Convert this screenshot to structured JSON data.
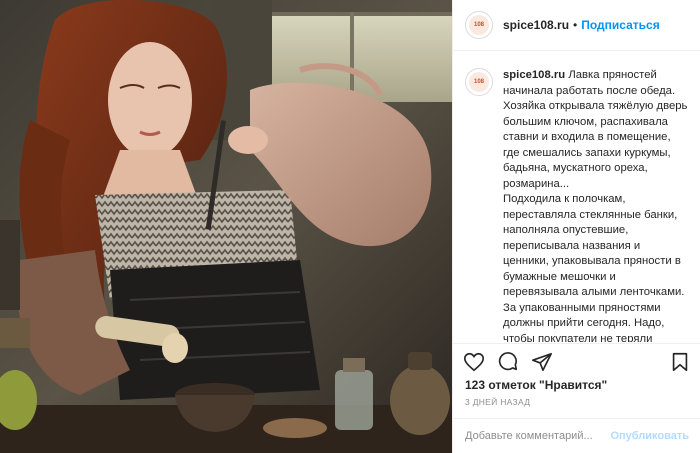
{
  "post": {
    "photo_alt": "post-photo",
    "username": "spice108.ru",
    "separator": "•",
    "follow_label": "Подписаться",
    "avatar_logo_text": "108",
    "caption_username": "spice108.ru",
    "caption_text": "Лавка пряностей начинала работать после обеда. Хозяйка открывала тяжёлую дверь большим ключом, распахивала ставни и входила в помещение, где смешались запахи куркумы, бадьяна, мускатного ореха, розмарина...\nПодходила к полочкам, переставляла стеклянные банки, наполняла опустевшие, переписывала названия и ценники, упаковывала пряности в бумажные мешочки и перевязывала алыми ленточками. За упакованными пряностями должны прийти сегодня. Надо, чтобы покупатели не теряли время, ожидая её. Лучше всё сделать заранее.\nЧас времени она тратила на то",
    "likes": "123 отметок \"Нравится\"",
    "time_ago": "3 дней назад",
    "comment_placeholder": "Добавьте комментарий...",
    "publish_label": "Опубликовать"
  },
  "icons": {
    "like": "heart-icon",
    "comment": "comment-icon",
    "share": "share-icon",
    "save": "bookmark-icon"
  },
  "colors": {
    "accent": "#0095f6",
    "publish_disabled": "#b3dbff",
    "text": "#262626",
    "muted": "#8e8e8e",
    "border": "#efefef"
  }
}
